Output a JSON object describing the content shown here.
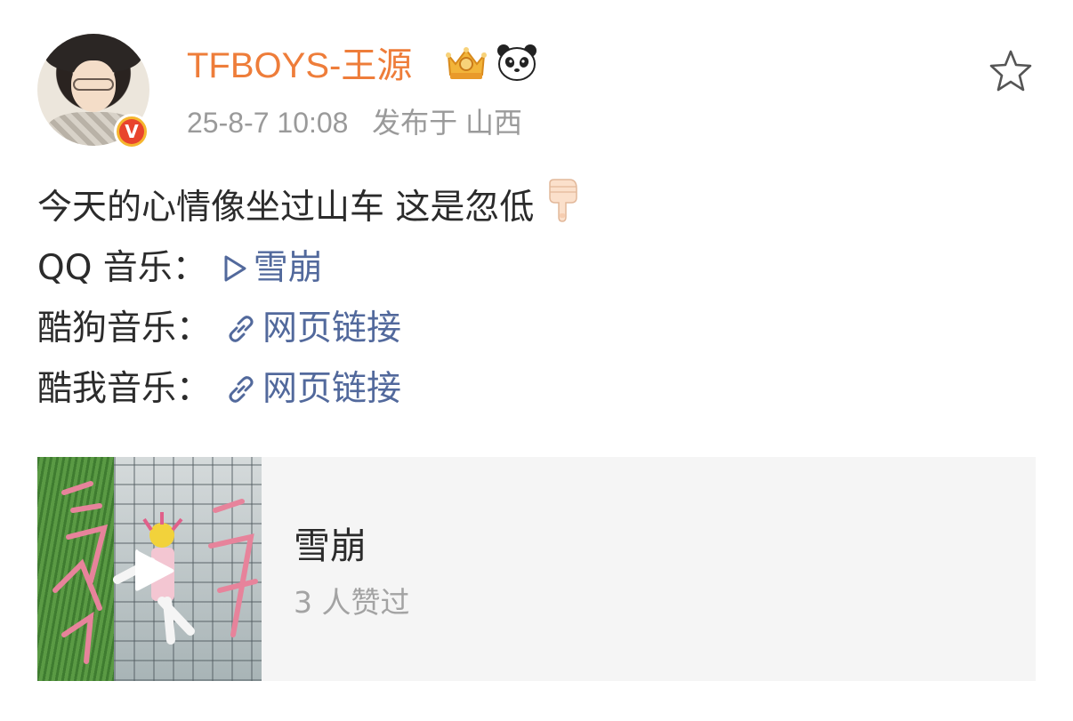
{
  "post": {
    "username": "TFBOYS-王源",
    "timestamp": "25-8-7 10:08",
    "location": "发布于 山西",
    "verified_badge": "V",
    "icons": [
      "crown-icon",
      "panda-icon",
      "star-icon",
      "finger-pointing-down-icon",
      "play-triangle-icon",
      "link-icon"
    ],
    "colors": {
      "username": "#ee7d3a",
      "link": "#52699c",
      "meta": "#9a9a9a",
      "card_bg": "#f5f5f5"
    }
  },
  "content": {
    "text": "今天的心情像坐过山车 这是忽低",
    "qq_label": "QQ 音乐：",
    "qq_link": "雪崩",
    "kugou_label": "酷狗音乐：",
    "kugou_link": "网页链接",
    "kuwo_label": "酷我音乐：",
    "kuwo_link": "网页链接"
  },
  "music_card": {
    "title": "雪崩",
    "likes": "3 人赞过"
  }
}
